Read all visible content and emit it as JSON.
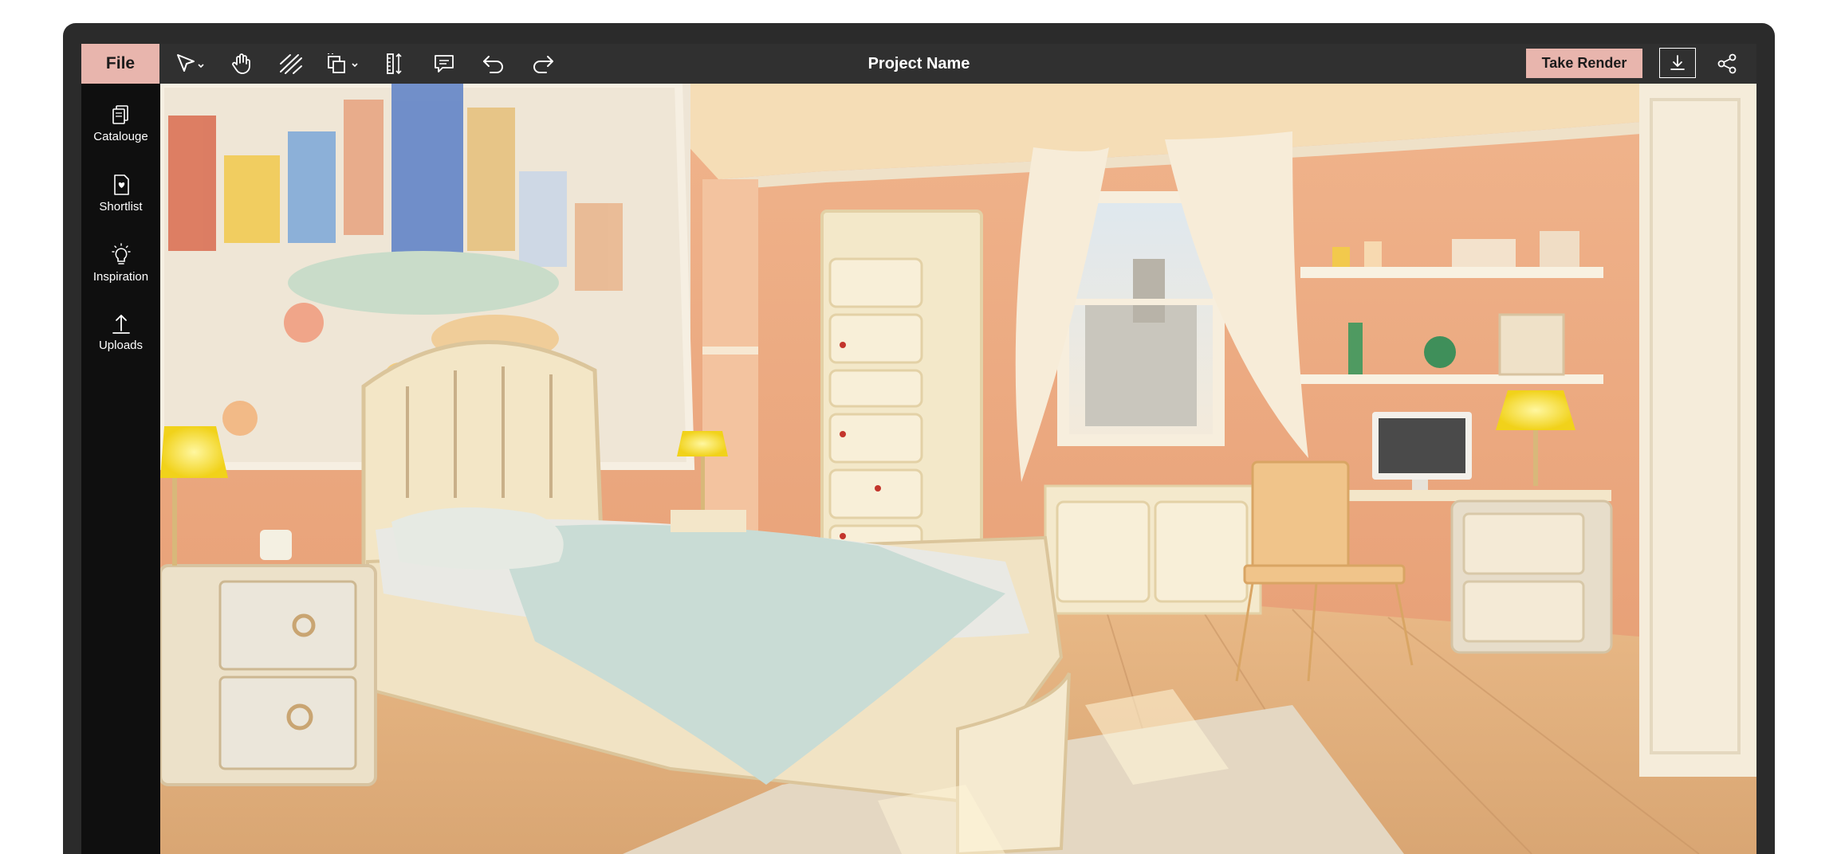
{
  "toolbar": {
    "file_label": "File",
    "project_name": "Project Name",
    "take_render_label": "Take Render",
    "tools": [
      "select-tool",
      "pan-tool",
      "hatch-tool",
      "object-tool",
      "measure-tool",
      "comment-tool",
      "undo",
      "redo"
    ]
  },
  "sidebar": {
    "items": [
      {
        "label": "Catalouge",
        "icon": "catalogue-icon"
      },
      {
        "label": "Shortlist",
        "icon": "shortlist-icon"
      },
      {
        "label": "Inspiration",
        "icon": "lightbulb-icon"
      },
      {
        "label": "Uploads",
        "icon": "upload-icon"
      }
    ]
  },
  "canvas": {
    "content": "rendered-kids-bedroom-image"
  },
  "colors": {
    "accent": "#e8b5ad",
    "frame": "#2b2b2b",
    "toolbar": "#303030",
    "sidebar": "#0f0f0f"
  }
}
